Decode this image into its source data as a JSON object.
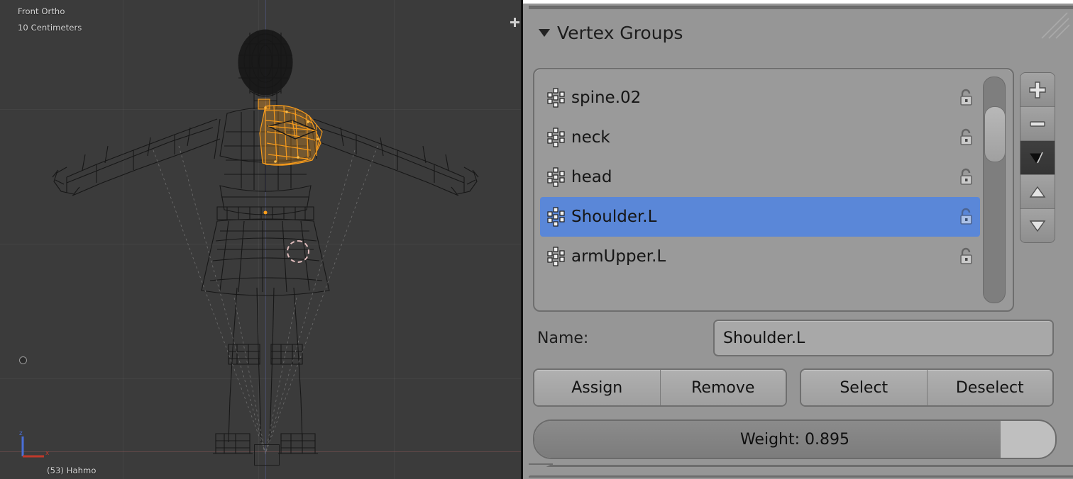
{
  "viewport": {
    "view_name": "Front Ortho",
    "grid_scale": "10 Centimeters",
    "object_info": "(53) Hahmo",
    "background_color": "#3b3b3b",
    "selection_color": "#ff9f1a",
    "wire_color": "#1a1a1a",
    "cursor_icon": "plus-cursor-icon",
    "gizmo_icon": "axis-gizmo-icon",
    "three_d_cursor_icon": "3d-cursor-icon"
  },
  "panel": {
    "title": "Vertex Groups",
    "collapse_icon": "triangle-down-icon",
    "grip_icon": "resize-grip-icon",
    "background_color": "#969696",
    "highlight_color": "#5a87d8"
  },
  "vertex_group_list": {
    "items": [
      {
        "label": "spine.02",
        "selected": false,
        "icon": "vertex-group-icon",
        "lock_icon": "unlocked-padlock-icon"
      },
      {
        "label": "neck",
        "selected": false,
        "icon": "vertex-group-icon",
        "lock_icon": "unlocked-padlock-icon"
      },
      {
        "label": "head",
        "selected": false,
        "icon": "vertex-group-icon",
        "lock_icon": "unlocked-padlock-icon"
      },
      {
        "label": "Shoulder.L",
        "selected": true,
        "icon": "vertex-group-icon",
        "lock_icon": "unlocked-padlock-icon"
      },
      {
        "label": "armUpper.L",
        "selected": false,
        "icon": "vertex-group-icon",
        "lock_icon": "unlocked-padlock-icon"
      }
    ],
    "scrollbar": {
      "thumb_top_percent": 13,
      "thumb_height_percent": 24
    }
  },
  "side_buttons": [
    {
      "name": "add-vertex-group-button",
      "icon": "plus-icon",
      "active": false
    },
    {
      "name": "remove-vertex-group-button",
      "icon": "minus-icon",
      "active": false
    },
    {
      "name": "vertex-group-specials-button",
      "icon": "dropdown-menu-icon",
      "active": true
    },
    {
      "name": "move-group-up-button",
      "icon": "triangle-up-icon",
      "active": false
    },
    {
      "name": "move-group-down-button",
      "icon": "triangle-down-icon",
      "active": false
    }
  ],
  "name_field": {
    "label": "Name:",
    "value": "Shoulder.L",
    "placeholder": "Name"
  },
  "actions": {
    "assign": "Assign",
    "remove": "Remove",
    "select": "Select",
    "deselect": "Deselect"
  },
  "weight": {
    "label": "Weight: 0.895",
    "value": 0.895,
    "min": 0,
    "max": 1,
    "fill_percent": 89.5
  }
}
